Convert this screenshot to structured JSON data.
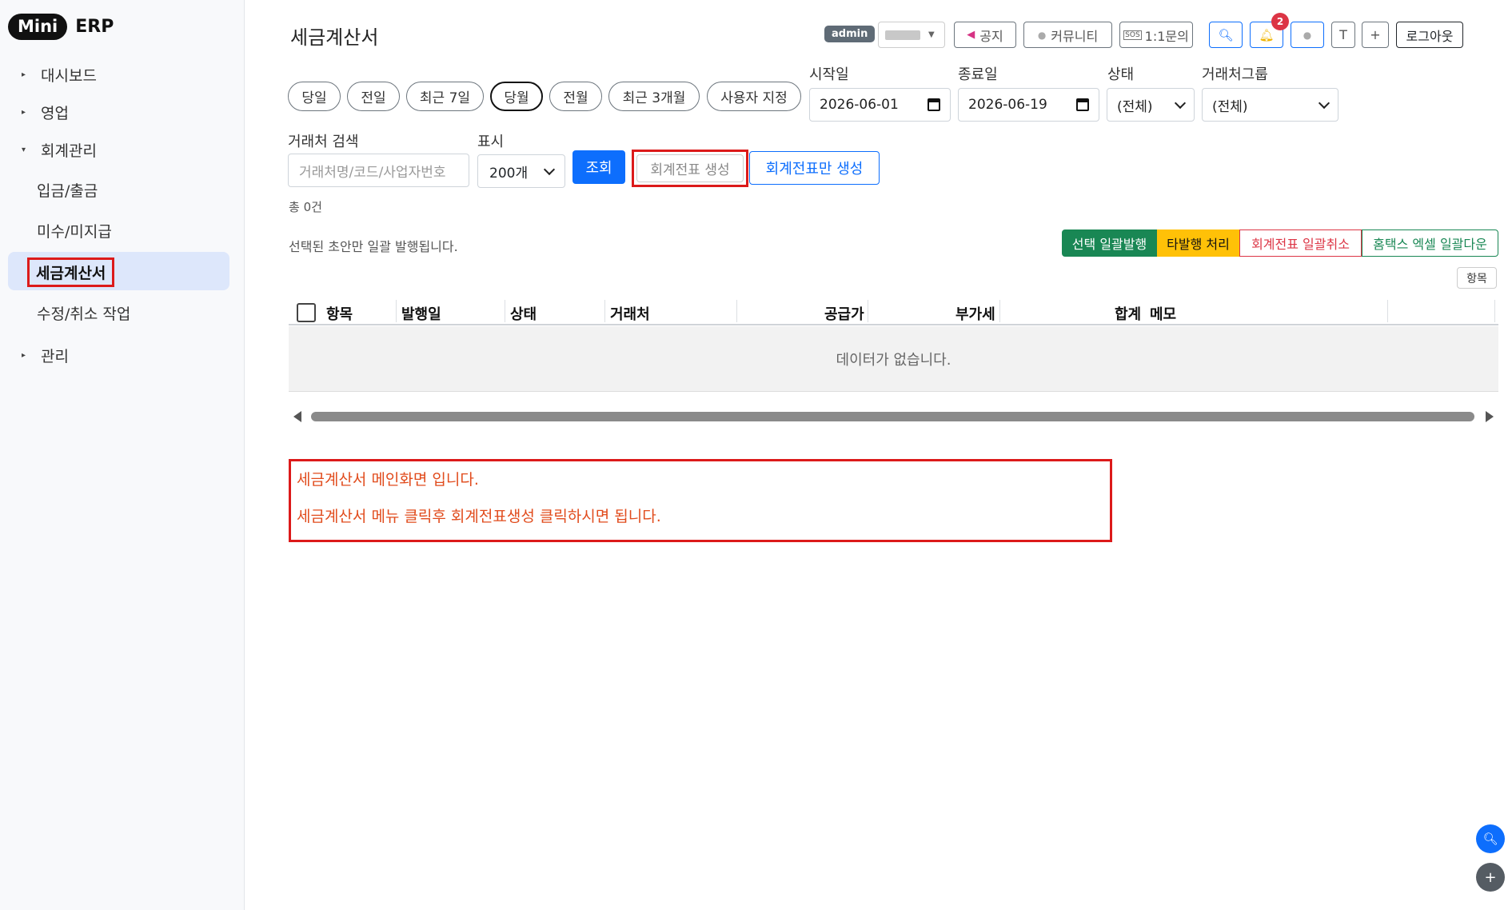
{
  "brand": {
    "mini": "Mini",
    "erp": "ERP"
  },
  "sidebar": {
    "items": [
      {
        "label": "대시보드"
      },
      {
        "label": "영업"
      },
      {
        "label": "회계관리"
      },
      {
        "label": "관리"
      }
    ],
    "sub_items": [
      {
        "label": "입금/출금"
      },
      {
        "label": "미수/미지급"
      },
      {
        "label": "세금계산서"
      },
      {
        "label": "수정/취소 작업"
      }
    ]
  },
  "header": {
    "title": "세금계산서",
    "admin_badge": "admin",
    "notice": "공지",
    "community": "커뮤니티",
    "inquiry": "1:1문의",
    "notif_count": "2",
    "t_btn": "T",
    "plus_btn": "+",
    "logout": "로그아웃"
  },
  "filters": {
    "periods": [
      "당일",
      "전일",
      "최근 7일",
      "당월",
      "전월",
      "최근 3개월",
      "사용자 지정"
    ],
    "active_period": "당월",
    "start_label": "시작일",
    "start_value": "2026-06-01",
    "end_label": "종료일",
    "end_value": "2026-06-19",
    "status_label": "상태",
    "status_value": "(전체)",
    "group_label": "거래처그룹",
    "group_value": "(전체)",
    "search_label": "거래처 검색",
    "search_placeholder": "거래처명/코드/사업자번호",
    "display_label": "표시",
    "display_value": "200개",
    "query_button": "조회",
    "generate_button": "회계전표 생성",
    "generate_only_button": "회계전표만 생성"
  },
  "summary": {
    "total": "총 0건",
    "note": "선택된 초안만 일괄 발행됩니다."
  },
  "bulk_actions": {
    "issue": "선택 일괄발행",
    "other_issue": "타발행 처리",
    "cancel_voucher": "회계전표 일괄취소",
    "hometax_download": "홈택스 엑셀 일괄다운"
  },
  "columns_button": "항목",
  "table": {
    "headers": [
      "항목",
      "발행일",
      "상태",
      "거래처",
      "공급가",
      "부가세",
      "합계",
      "메모"
    ],
    "empty_text": "데이터가 없습니다."
  },
  "annotation": {
    "line1": "세금계산서 메인화면 입니다.",
    "line2": "세금계산서 메뉴 클릭후 회계전표생성 클릭하시면 됩니다."
  },
  "colors": {
    "primary": "#0d6efd",
    "success": "#198754",
    "warning": "#ffc107",
    "danger": "#dc3545",
    "annotation_red": "#dc1a1a"
  }
}
